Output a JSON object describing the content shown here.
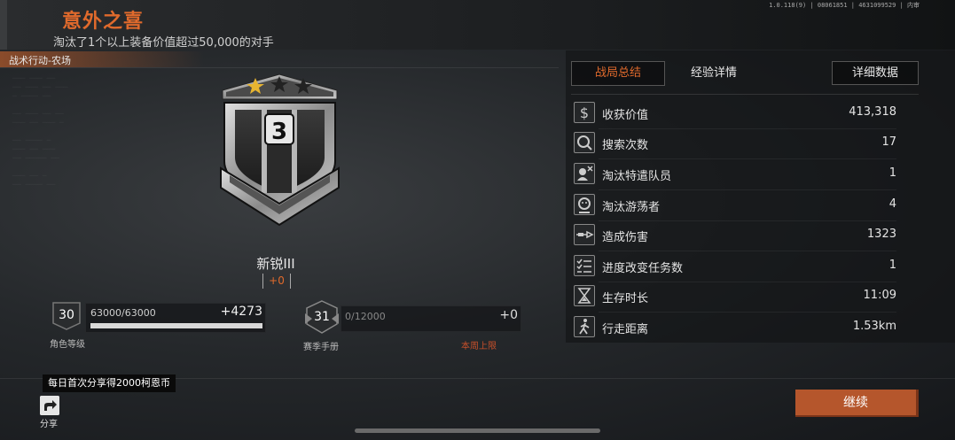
{
  "banner": {
    "title": "意外之喜",
    "subtitle": "淘汰了1个以上装备价值超过50,000的对手",
    "version": "1.0.118(9) | 08061851 | 4631099529 | 内审"
  },
  "map": {
    "label": "战术行动-农场"
  },
  "rank": {
    "name": "新锐III",
    "delta": "+0",
    "tier_number": "3",
    "stars_filled": 1,
    "stars_total": 3
  },
  "character_level": {
    "level": "30",
    "xp": "63000/63000",
    "gain": "+4273",
    "progress": 1.0,
    "label": "角色等级"
  },
  "season_pass": {
    "level": "31",
    "xp": "0/12000",
    "gain": "+0",
    "progress": 0.0,
    "label": "赛季手册",
    "cap_note": "本周上限"
  },
  "tabs": {
    "summary": "战局总结",
    "experience": "经验详情",
    "detail": "详细数据"
  },
  "stats": [
    {
      "icon": "dollar-icon",
      "label": "收获价值",
      "value": "413,318"
    },
    {
      "icon": "search-icon",
      "label": "搜索次数",
      "value": "17"
    },
    {
      "icon": "operator-eliminated-icon",
      "label": "淘汰特遣队员",
      "value": "1"
    },
    {
      "icon": "wanderer-eliminated-icon",
      "label": "淘汰游荡者",
      "value": "4"
    },
    {
      "icon": "damage-icon",
      "label": "造成伤害",
      "value": "1323"
    },
    {
      "icon": "task-progress-icon",
      "label": "进度改变任务数",
      "value": "1"
    },
    {
      "icon": "hourglass-icon",
      "label": "生存时长",
      "value": "11:09"
    },
    {
      "icon": "walking-icon",
      "label": "行走距离",
      "value": "1.53km"
    }
  ],
  "share": {
    "tip": "每日首次分享得2000柯恩币",
    "label": "分享"
  },
  "continue": {
    "label": "继续"
  },
  "colors": {
    "accent": "#e06a2c",
    "button": "#b5562c"
  }
}
